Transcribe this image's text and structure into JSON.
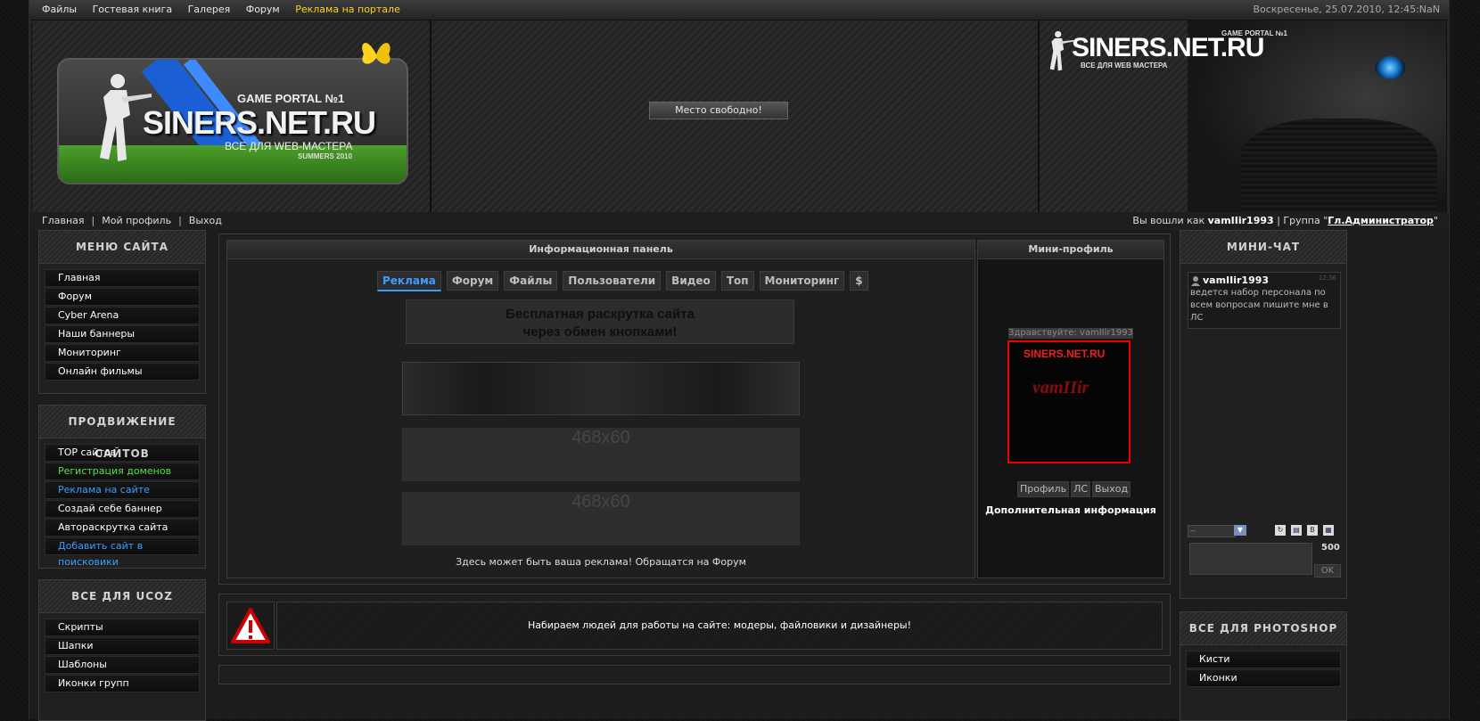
{
  "topbar": {
    "nav": [
      "Файлы",
      "Гостевая книга",
      "Галерея",
      "Форум"
    ],
    "ad_link": "Реклама на портале",
    "datetime": "Воскресенье, 25.07.2010, 12:45:NaN"
  },
  "header": {
    "logo": {
      "game_portal": "GAME PORTAL №1",
      "brand": "SINERS.NET.RU",
      "tagline": "ВСЕ ДЛЯ WEB-МАСТЕРА",
      "season": "SUMMERS 2010"
    },
    "free_slot": "Место свободно!",
    "right_logo": {
      "game_portal": "GAME PORTAL №1",
      "brand": "SINERS.NET.RU",
      "tagline": "ВСЕ ДЛЯ WEB МАСТЕРА"
    }
  },
  "userbar": {
    "nav": [
      "Главная",
      "Мой профиль",
      "Выход"
    ],
    "logged_as_label": "Вы вошли как",
    "username": "vamIIir1993",
    "group_label": "| Группа \"",
    "group": "Гл.Администратор",
    "group_close": "\""
  },
  "menu_site": {
    "title": "МЕНЮ САЙТА",
    "items": [
      "Главная",
      "Форум",
      "Cyber Arena",
      "Наши баннеры",
      "Мониторинг",
      "Онлайн фильмы"
    ]
  },
  "promotion": {
    "title": "ПРОДВИЖЕНИЕ САЙТОВ",
    "items": [
      "TOP сайтов",
      "Регистрация доменов",
      "Реклама на сайте",
      "Создай себе баннер",
      "Автораскрутка сайта",
      "Добавить сайт в поисковики"
    ]
  },
  "ucoz": {
    "title": "ВСЕ ДЛЯ UCOZ",
    "items": [
      "Скрипты",
      "Шапки",
      "Шаблоны",
      "Иконки групп"
    ]
  },
  "info_panel": {
    "title": "Информационная панель",
    "tabs": [
      "Реклама",
      "Форум",
      "Файлы",
      "Пользователи",
      "Видео",
      "Топ",
      "Мониторинг",
      "$"
    ],
    "promo_line1": "Бесплатная раскрутка сайта",
    "promo_line2": "через обмен кнопками!",
    "banner_size_1": "468x60",
    "banner_size_2": "468x60",
    "note": "Здесь может быть ваша реклама! Обращатся на Форум"
  },
  "mini_profile": {
    "title": "Мини-профиль",
    "greeting": "Здравствуйте: vamIIir1993",
    "avatar_brand": "SINERS.NET.RU",
    "avatar_name": "vamIIir",
    "buttons": [
      "Профиль",
      "ЛС",
      "Выход"
    ],
    "extra": "Дополнительная информация"
  },
  "notice": {
    "text": "Набираем людей для работы на сайте: модеры, файловики и дизайнеры!"
  },
  "mini_chat": {
    "title": "МИНИ-ЧАТ",
    "message": {
      "user": "vamIIir1993",
      "time": "12:36",
      "text": "ведется набор персонала по всем вопросам пишите мне в ЛС"
    },
    "select_value": "--",
    "counter": "500",
    "ok": "OK"
  },
  "photoshop": {
    "title": "ВСЕ ДЛЯ PHOTOSHOP",
    "items": [
      "Кисти",
      "Иконки"
    ]
  },
  "colors": {
    "accent_blue": "#3e9bff",
    "accent_green": "#57e24a",
    "accent_yellow": "#ffd21f",
    "avatar_border": "#ee0000"
  }
}
